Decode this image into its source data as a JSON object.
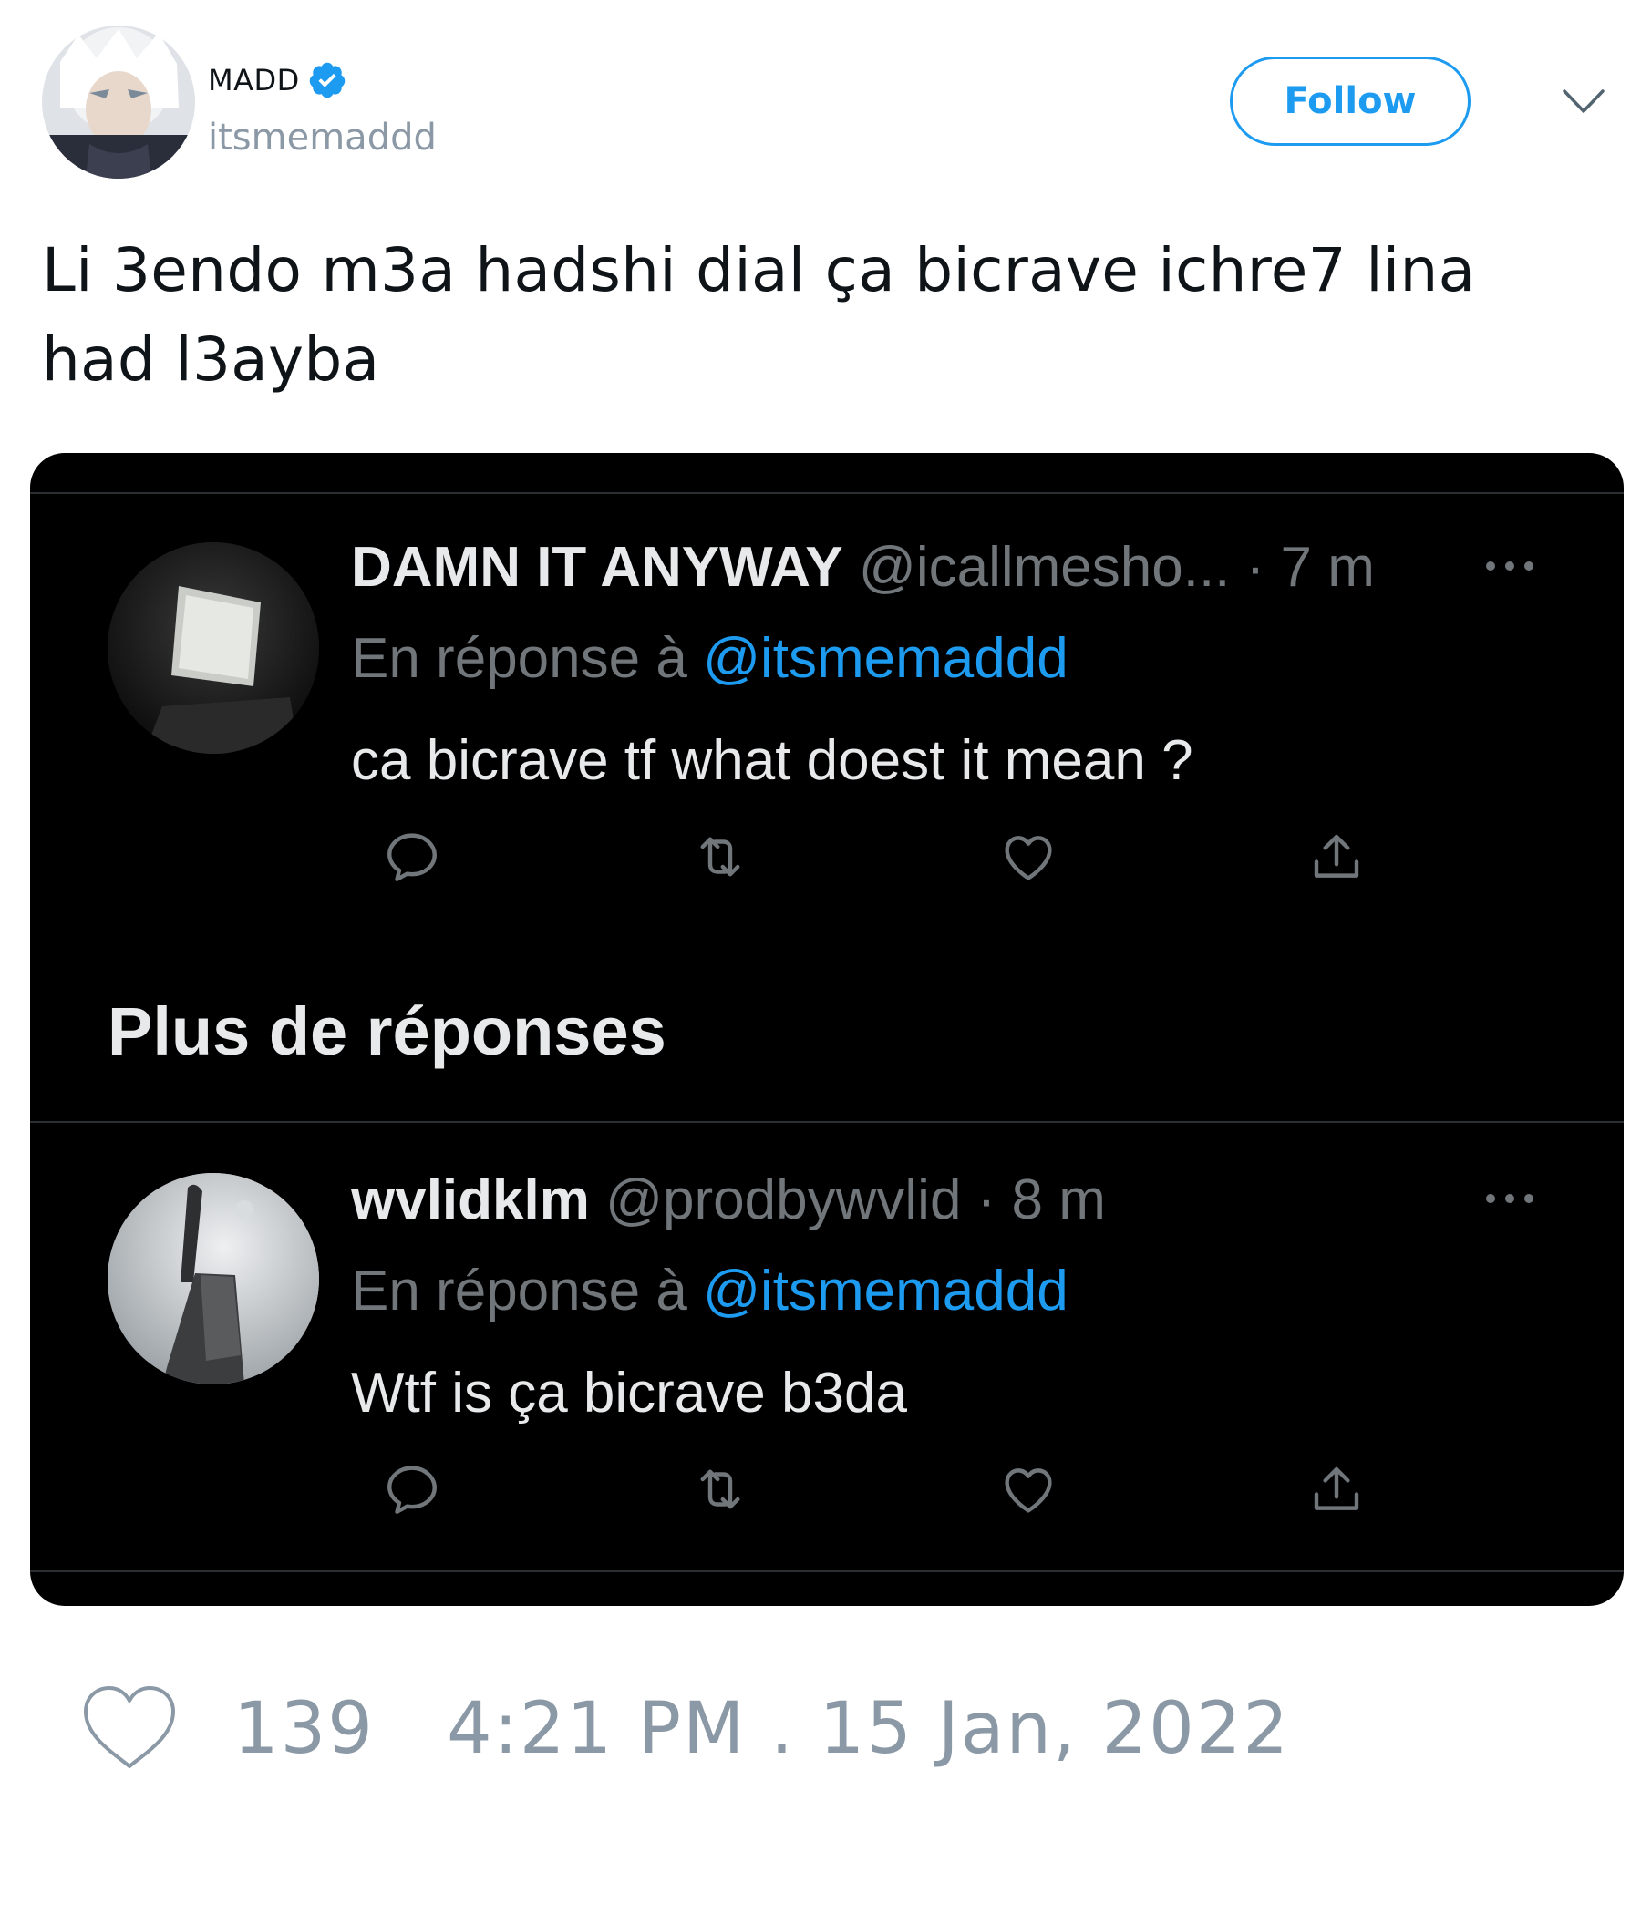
{
  "author": {
    "display_name": "MADD",
    "handle": "itsmemaddd",
    "verified": true
  },
  "follow_label": "Follow",
  "tweet": {
    "text_line1": "Li 3endo m3a hadshi dial ça bicrave ichre7 lina",
    "text_line2": "had l3ayba"
  },
  "screenshot": {
    "replies": [
      {
        "name": "DAMN IT ANYWAY",
        "handle": "@icallmesho...",
        "time": "· 7 m",
        "context_prefix": "En réponse à",
        "mention": "@itsmemaddd",
        "text": "ca bicrave tf what doest it mean ?"
      },
      {
        "name": "wvlidklm",
        "handle": "@prodbywvlid",
        "time": "· 8 m",
        "context_prefix": "En réponse à",
        "mention": "@itsmemaddd",
        "text": "Wtf is ça bicrave b3da"
      }
    ],
    "section_title": "Plus de réponses"
  },
  "footer": {
    "like_count": "139",
    "timestamp": "4:21 PM . 15 Jan, 2022"
  },
  "colors": {
    "accent": "#1d9bf0",
    "muted": "#8b98a5",
    "dark_bg": "#000000"
  }
}
